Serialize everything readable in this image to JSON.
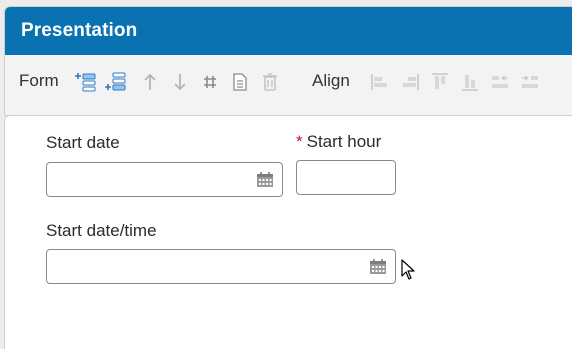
{
  "panel": {
    "title": "Presentation"
  },
  "toolbar": {
    "form_label": "Form",
    "align_label": "Align",
    "form_icons": [
      "insert-row-above-icon",
      "insert-row-below-icon",
      "move-up-icon",
      "move-down-icon",
      "grid-icon",
      "document-icon",
      "delete-icon"
    ],
    "align_icons": [
      "align-left-icon",
      "align-right-icon",
      "align-top-icon",
      "align-bottom-icon",
      "distribute-left-icon",
      "distribute-right-icon"
    ]
  },
  "form": {
    "start_date": {
      "label": "Start date",
      "value": ""
    },
    "start_hour": {
      "label": "Start hour",
      "required_marker": "*",
      "value": ""
    },
    "start_datetime": {
      "label": "Start date/time",
      "value": ""
    }
  },
  "colors": {
    "header": "#0a72b0",
    "accent_icon": "#2a79c9",
    "required": "#c8102e"
  }
}
